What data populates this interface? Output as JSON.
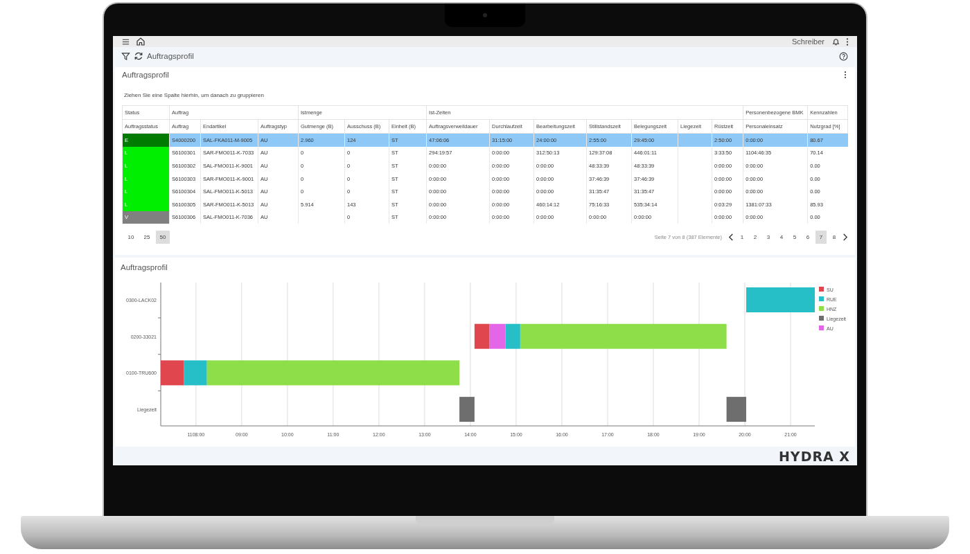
{
  "top_bar": {
    "user": "Schreiber"
  },
  "toolbar": {
    "title": "Auftragsprofil"
  },
  "grid_panel": {
    "title": "Auftragsprofil",
    "group_hint": "Ziehen Sie eine Spalte hierhin, um danach zu gruppieren",
    "column_groups": [
      {
        "label": "Status",
        "columns": [
          "Auftragsstatus"
        ]
      },
      {
        "label": "Auftrag",
        "columns": [
          "Auftrag",
          "Endartikel",
          "Auftragstyp"
        ]
      },
      {
        "label": "Istmenge",
        "columns": [
          "Gutmenge (B)",
          "Ausschuss (B)",
          "Einheit (B)"
        ]
      },
      {
        "label": "Ist-Zeiten",
        "columns": [
          "Auftragsverweildauer",
          "Durchlaufzeit",
          "Bearbeitungszeit",
          "Stillstandszeit",
          "Belegungszeit",
          "Liegezeit",
          "Rüstzeit"
        ]
      },
      {
        "label": "Personenbezogene BMK",
        "columns": [
          "Personaleinsatz"
        ]
      },
      {
        "label": "Kennzahlen",
        "columns": [
          "Nutzgrad [%]"
        ]
      }
    ],
    "rows": [
      {
        "status": "E",
        "color": "#007a00",
        "selected": true,
        "cells": [
          "S4000200",
          "SAL-FKA011-M-9005",
          "AU",
          "2.960",
          "124",
          "ST",
          "47:06:06",
          "31:15:00",
          "24:00:00",
          "2:55:00",
          "29:45:00",
          null,
          "2:50:00",
          "0:00:00",
          "80.67"
        ]
      },
      {
        "status": "L",
        "color": "#00ee00",
        "selected": false,
        "cells": [
          "S6100301",
          "SAR-FMO011-K-7033",
          "AU",
          "0",
          "0",
          "ST",
          "294:19:57",
          "0:00:00",
          "312:50:13",
          "129:37:08",
          "446:01:11",
          null,
          "3:33:50",
          "1104:46:35",
          "70.14"
        ]
      },
      {
        "status": "L",
        "color": "#00ee00",
        "selected": false,
        "cells": [
          "S6100302",
          "SAL-FMO011-K-9001",
          "AU",
          "0",
          "0",
          "ST",
          "0:00:00",
          "0:00:00",
          "0:00:00",
          "48:33:39",
          "48:33:39",
          null,
          "0:00:00",
          "0:00:00",
          "0.00"
        ]
      },
      {
        "status": "L",
        "color": "#00ee00",
        "selected": false,
        "cells": [
          "S6100303",
          "SAR-FMO011-K-9001",
          "AU",
          "0",
          "0",
          "ST",
          "0:00:00",
          "0:00:00",
          "0:00:00",
          "37:46:39",
          "37:46:39",
          null,
          "0:00:00",
          "0:00:00",
          "0.00"
        ]
      },
      {
        "status": "L",
        "color": "#00ee00",
        "selected": false,
        "cells": [
          "S6100304",
          "SAL-FMO011-K-5013",
          "AU",
          "0",
          "0",
          "ST",
          "0:00:00",
          "0:00:00",
          "0:00:00",
          "31:35:47",
          "31:35:47",
          null,
          "0:00:00",
          "0:00:00",
          "0.00"
        ]
      },
      {
        "status": "L",
        "color": "#00ee00",
        "selected": false,
        "cells": [
          "S6100305",
          "SAR-FMO011-K-5013",
          "AU",
          "5.914",
          "143",
          "ST",
          "0:00:00",
          "0:00:00",
          "460:14:12",
          "75:16:33",
          "535:34:14",
          null,
          "0:03:29",
          "1381:07:33",
          "85.93"
        ]
      },
      {
        "status": "V",
        "color": "#808080",
        "selected": false,
        "cells": [
          "S6100306",
          "SAL-FMO011-K-7036",
          "AU",
          null,
          "0",
          "ST",
          "0:00:00",
          "0:00:00",
          "0:00:00",
          "0:00:00",
          "0:00:00",
          null,
          "0:00:00",
          "0:00:00",
          "0.00"
        ]
      }
    ],
    "page_sizes": [
      {
        "label": "10",
        "selected": false
      },
      {
        "label": "25",
        "selected": false
      },
      {
        "label": "50",
        "selected": true
      }
    ],
    "pager": {
      "summary": "Seite 7 von 8 (387 Elemente)",
      "pages": [
        {
          "label": "1",
          "selected": false
        },
        {
          "label": "2",
          "selected": false
        },
        {
          "label": "3",
          "selected": false
        },
        {
          "label": "4",
          "selected": false
        },
        {
          "label": "5",
          "selected": false
        },
        {
          "label": "6",
          "selected": false
        },
        {
          "label": "7",
          "selected": true
        },
        {
          "label": "8",
          "selected": false
        }
      ]
    }
  },
  "chart_panel": {
    "title": "Auftragsprofil",
    "rows": [
      "0300-LACK02",
      "0200-33021",
      "0100-TRU600",
      "Liegezeit"
    ],
    "time_ticks": [
      "1108:00",
      "09:00",
      "10:00",
      "11:00",
      "12:00",
      "13:00",
      "14:00",
      "15:00",
      "16:00",
      "17:00",
      "18:00",
      "19:00",
      "20:00",
      "21:00"
    ],
    "legend": [
      {
        "name": "SU",
        "color": "#e0464e"
      },
      {
        "name": "RUE",
        "color": "#26bfc8"
      },
      {
        "name": "HNZ",
        "color": "#8ede4a"
      },
      {
        "name": "Liegezeit",
        "color": "#6e6e6e"
      },
      {
        "name": "AU",
        "color": "#e466e8"
      }
    ]
  },
  "footer": {
    "logo": "HYDRA X"
  }
}
